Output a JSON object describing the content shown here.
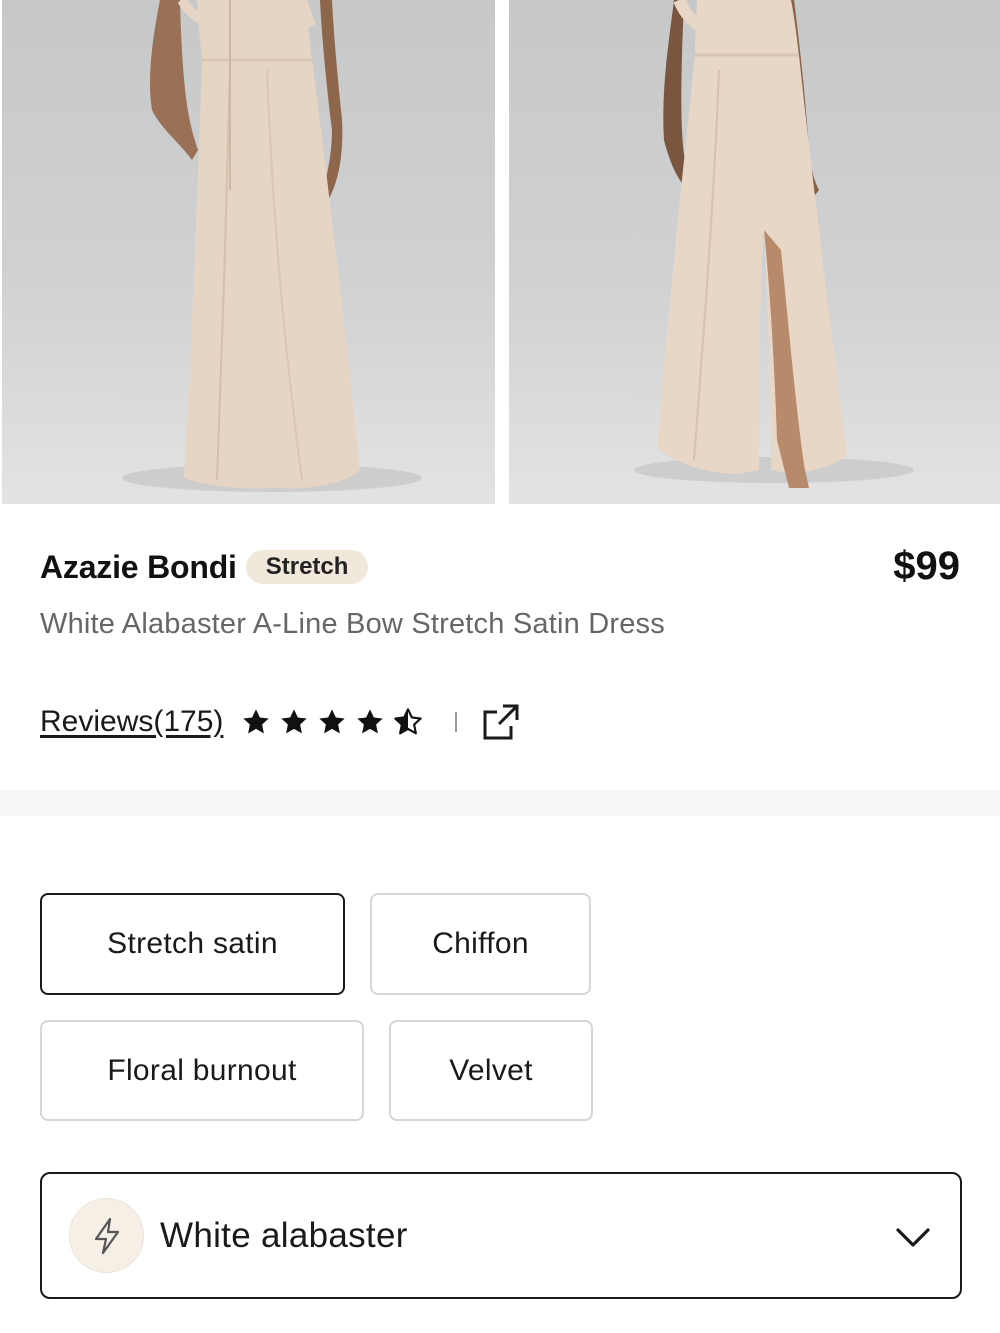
{
  "product": {
    "brand": "Azazie Bondi",
    "badge": "Stretch",
    "price": "$99",
    "description": "White Alabaster A-Line Bow Stretch Satin Dress",
    "reviews_label": "Reviews(175)",
    "rating": 4.5,
    "rating_max": 5
  },
  "gallery": {
    "images": [
      {
        "name": "dress-back-view-photo"
      },
      {
        "name": "dress-front-slit-view-photo"
      }
    ]
  },
  "fabrics": {
    "selected": "Stretch satin",
    "options": [
      "Stretch satin",
      "Chiffon",
      "Floral burnout",
      "Velvet"
    ]
  },
  "color": {
    "selected": "White alabaster",
    "icon": "lightning-icon",
    "swatch_color": "#f5efe6"
  },
  "icons": {
    "share": "external-link-icon",
    "dropdown": "chevron-down-icon",
    "star": "star-icon"
  },
  "colors": {
    "badge_bg": "#f1e8dc",
    "dress": "#e8d8c8",
    "text_muted": "#666666",
    "border_selected": "#1a1a1a"
  }
}
